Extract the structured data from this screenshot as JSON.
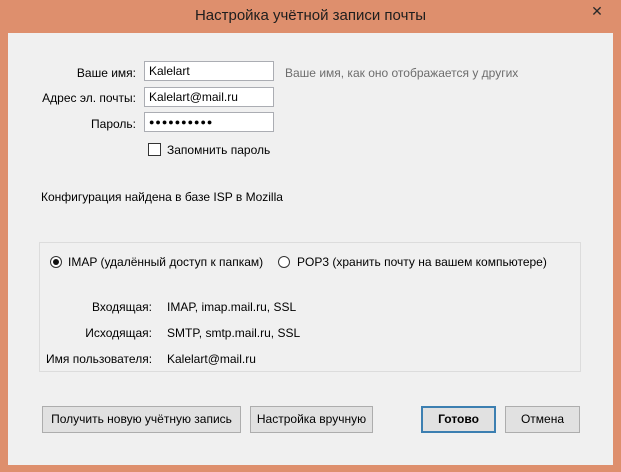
{
  "window": {
    "title": "Настройка учётной записи почты",
    "close_glyph": "✕"
  },
  "form": {
    "name_label": "Ваше имя:",
    "name_value": "Kalelart",
    "name_hint": "Ваше имя, как оно отображается у других",
    "email_label": "Адрес эл. почты:",
    "email_value": "Kalelart@mail.ru",
    "password_label": "Пароль:",
    "password_value": "●●●●●●●●●●",
    "remember_label": "Запомнить пароль",
    "remember_checked": false
  },
  "status": {
    "text": "Конфигурация найдена в базе ISP в Mozilla"
  },
  "protocol": {
    "imap_label": "IMAP (удалённый доступ к папкам)",
    "pop3_label": "POP3 (хранить почту на вашем компьютере)",
    "selected": "IMAP"
  },
  "server": {
    "incoming_label": "Входящая:",
    "incoming_value": "IMAP, imap.mail.ru, SSL",
    "outgoing_label": "Исходящая:",
    "outgoing_value": "SMTP, smtp.mail.ru, SSL",
    "username_label": "Имя пользователя:",
    "username_value": "Kalelart@mail.ru"
  },
  "buttons": {
    "get_new": "Получить новую учётную запись",
    "manual": "Настройка вручную",
    "done": "Готово",
    "cancel": "Отмена"
  },
  "colors": {
    "frame": "#de8f6d",
    "client": "#f0f0f0",
    "default_button_border": "#3c7fb1"
  }
}
